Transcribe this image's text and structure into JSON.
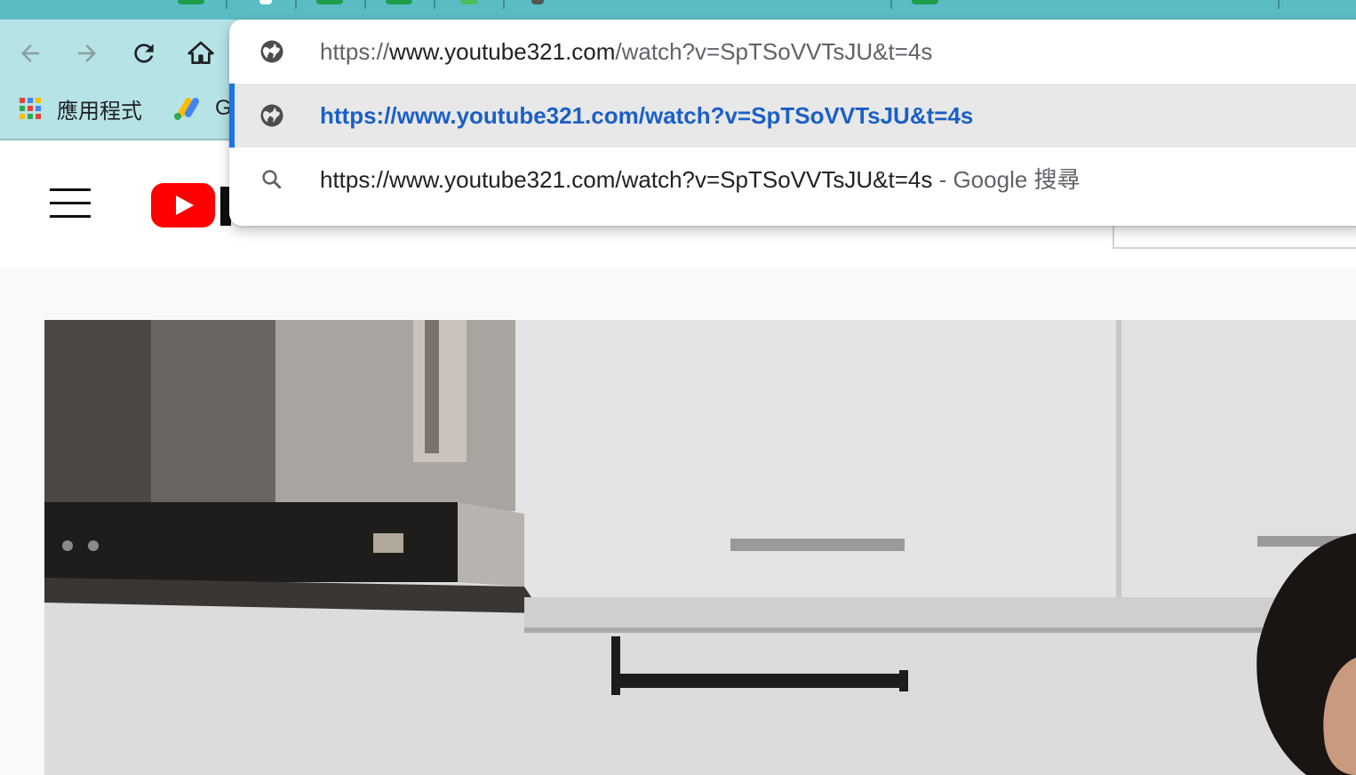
{
  "browser": {
    "omnibox": {
      "input": {
        "scheme": "https://",
        "host": "www.youtube321.com",
        "path": "/watch?v=SpTSoVVTsJU&t=4s"
      },
      "suggestions": [
        {
          "type": "url",
          "text": "https://www.youtube321.com/watch?v=SpTSoVVTsJU&t=4s",
          "selected": true
        },
        {
          "type": "search",
          "text": "https://www.youtube321.com/watch?v=SpTSoVVTsJU&t=4s",
          "suffix": "- Google 搜尋"
        }
      ]
    },
    "bookmarks": {
      "apps_label": "應用程式",
      "partial_label": "G"
    },
    "icons": {
      "back": "back-arrow-icon",
      "forward": "forward-arrow-icon",
      "reload": "reload-icon",
      "home": "home-icon",
      "globe": "globe-icon",
      "search": "search-icon"
    },
    "colors": {
      "tabstrip": "#5bbcc4",
      "toolbar": "#b6e3e6",
      "accent": "#1a73e8",
      "selected_text": "#1a5fc8",
      "youtube_red": "#ff0000"
    }
  }
}
